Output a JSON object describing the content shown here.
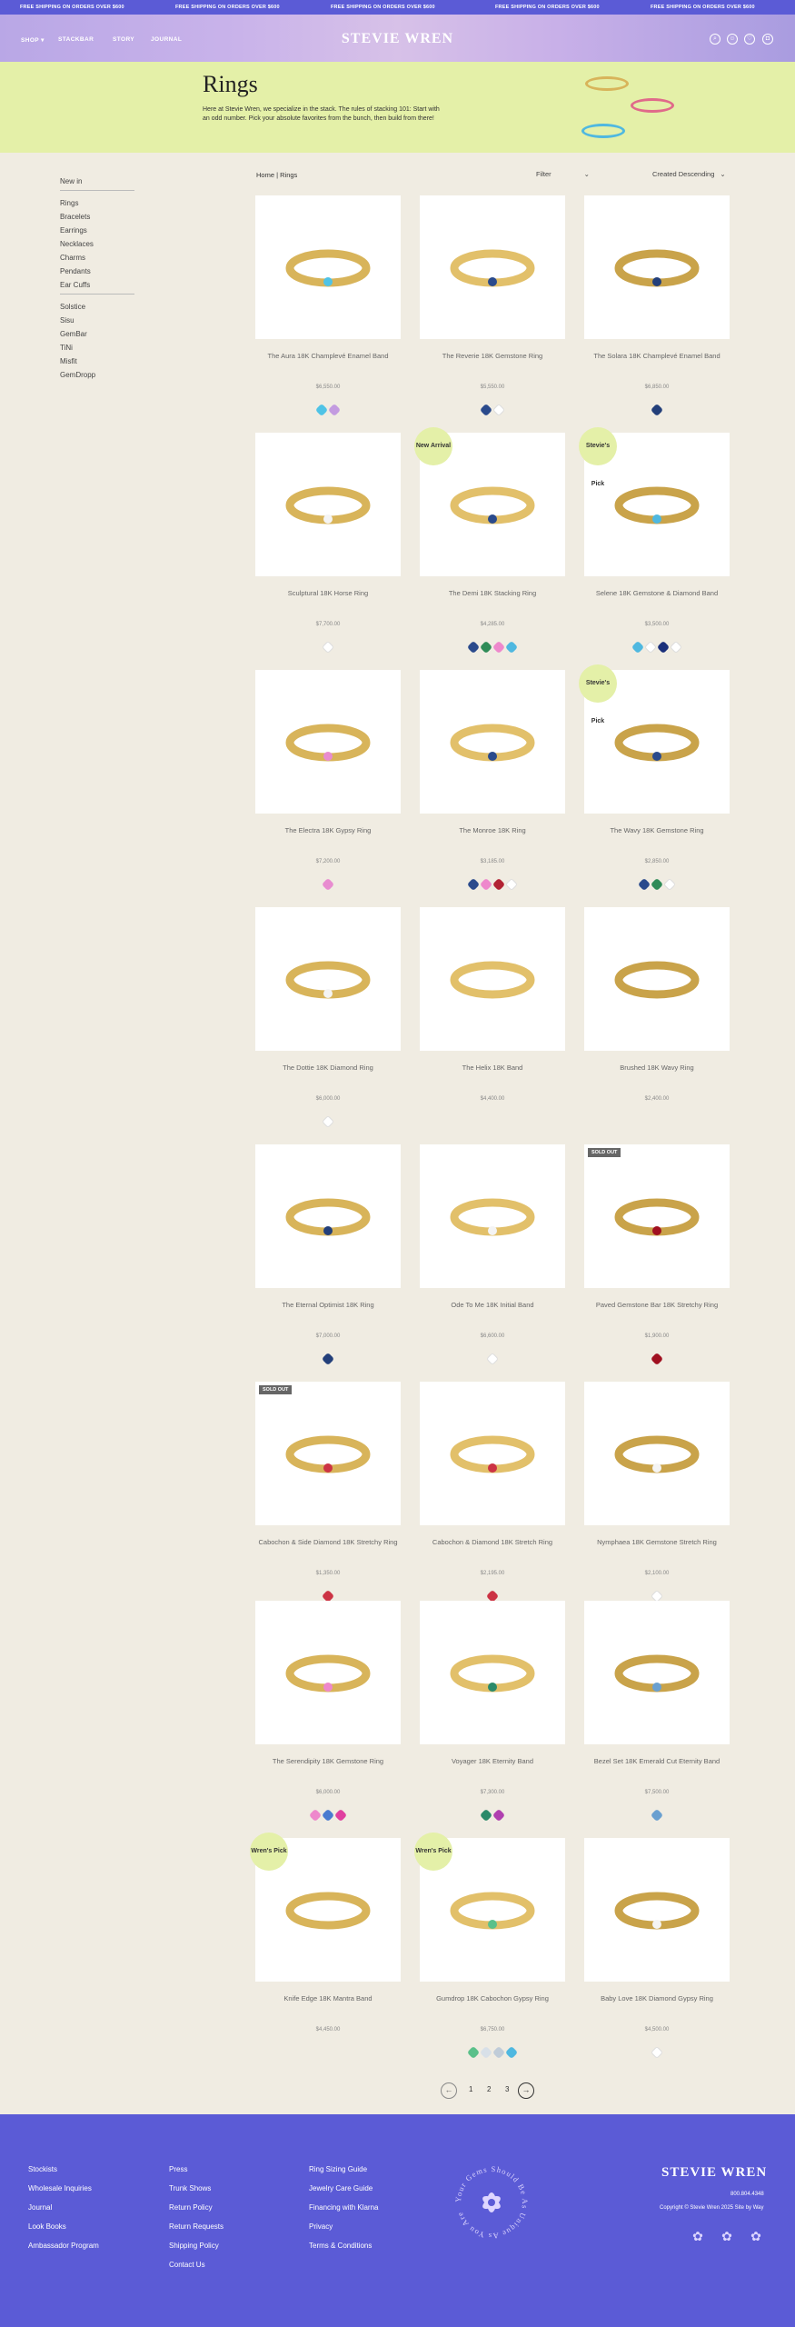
{
  "topbar": {
    "message": "FREE SHIPPING ON ORDERS OVER $600"
  },
  "header": {
    "nav": [
      "SHOP ▾",
      "STACKBAR",
      "STORY",
      "JOURNAL"
    ],
    "logo": "STEVIE WREN",
    "icons": [
      "search-icon",
      "account-icon",
      "wishlist-icon",
      "cart-icon"
    ]
  },
  "hero": {
    "title": "Rings",
    "description": "Here at Stevie Wren, we specialize in the stack. The rules of stacking 101: Start with an odd number. Pick your absolute favorites from the bunch, then build from there!"
  },
  "sidebar": {
    "new_in": "New in",
    "categories": [
      "Rings",
      "Bracelets",
      "Earrings",
      "Necklaces",
      "Charms",
      "Pendants",
      "Ear Cuffs"
    ],
    "collections": [
      "Solstice",
      "Sisu",
      "GemBar",
      "TiNi",
      "Misfit",
      "GemDropp"
    ]
  },
  "toolbar": {
    "breadcrumb": "Home | Rings",
    "filter_label": "Filter",
    "sort_label": "Created Descending"
  },
  "products": [
    {
      "name": "The Aura 18K Champlevé Enamel Band",
      "price": "$6,550.00",
      "badge": "",
      "tag": "",
      "swatches": [
        "#4fc3e6",
        "#c39be0"
      ]
    },
    {
      "name": "The Reverie 18K Gemstone Ring",
      "price": "$5,550.00",
      "badge": "",
      "tag": "",
      "swatches": [
        "#2a4a8c",
        "#ffffff"
      ]
    },
    {
      "name": "The Solara 18K Champlevé Enamel Band",
      "price": "$6,850.00",
      "badge": "",
      "tag": "",
      "swatches": [
        "#233f7a"
      ]
    },
    {
      "name": "Sculptural 18K Horse Ring",
      "price": "$7,700.00",
      "badge": "",
      "tag": "",
      "swatches": [
        "#ffffff"
      ]
    },
    {
      "name": "The Demi 18K Stacking Ring",
      "price": "$4,285.00",
      "badge": "New Arrival",
      "tag": "",
      "swatches": [
        "#2a4a8c",
        "#2e8b57",
        "#ee88cc",
        "#4fb8e0"
      ]
    },
    {
      "name": "Selene 18K Gemstone & Diamond Band",
      "price": "$3,500.00",
      "badge": "Stevie's Pick",
      "tag": "",
      "swatches": [
        "#4fb8e0",
        "#ffffff",
        "#1a2f7a",
        "#ffffff"
      ]
    },
    {
      "name": "The Electra 18K Gypsy Ring",
      "price": "$7,200.00",
      "badge": "",
      "tag": "",
      "swatches": [
        "#e88cd0"
      ]
    },
    {
      "name": "The Monroe 18K Ring",
      "price": "$3,185.00",
      "badge": "",
      "tag": "",
      "swatches": [
        "#2a4a8c",
        "#ee88cc",
        "#b22233",
        "#ffffff"
      ]
    },
    {
      "name": "The Wavy 18K Gemstone Ring",
      "price": "$2,850.00",
      "badge": "Stevie's Pick",
      "tag": "",
      "swatches": [
        "#2a4a8c",
        "#2e8b57",
        "#ffffff"
      ]
    },
    {
      "name": "The Dottie 18K Diamond Ring",
      "price": "$6,000.00",
      "badge": "",
      "tag": "",
      "swatches": [
        "#ffffff"
      ]
    },
    {
      "name": "The Helix 18K Band",
      "price": "$4,400.00",
      "badge": "",
      "tag": "",
      "swatches": []
    },
    {
      "name": "Brushed 18K Wavy Ring",
      "price": "$2,400.00",
      "badge": "",
      "tag": "",
      "swatches": []
    },
    {
      "name": "The Eternal Optimist 18K Ring",
      "price": "$7,000.00",
      "badge": "",
      "tag": "",
      "swatches": [
        "#233f7a"
      ]
    },
    {
      "name": "Ode To Me 18K Initial Band",
      "price": "$6,600.00",
      "badge": "",
      "tag": "",
      "swatches": [
        "#ffffff"
      ]
    },
    {
      "name": "Paved Gemstone Bar 18K Stretchy Ring",
      "price": "$1,900.00",
      "badge": "",
      "tag": "SOLD OUT",
      "swatches": [
        "#a01020"
      ]
    },
    {
      "name": "Cabochon & Side Diamond 18K Stretchy Ring",
      "price": "$1,350.00",
      "badge": "",
      "tag": "SOLD OUT",
      "swatches": [
        "#cc3344"
      ]
    },
    {
      "name": "Cabochon & Diamond 18K Stretch Ring",
      "price": "$2,195.00",
      "badge": "",
      "tag": "",
      "swatches": [
        "#cc3344"
      ]
    },
    {
      "name": "Nymphaea 18K Gemstone Stretch Ring",
      "price": "$2,100.00",
      "badge": "",
      "tag": "",
      "swatches": [
        "#ffffff"
      ]
    },
    {
      "name": "The Serendipity 18K Gemstone Ring",
      "price": "$6,000.00",
      "badge": "",
      "tag": "",
      "swatches": [
        "#ee88cc",
        "#4a7bd0",
        "#e040a0"
      ]
    },
    {
      "name": "Voyager 18K Eternity Band",
      "price": "$7,300.00",
      "badge": "",
      "tag": "",
      "swatches": [
        "#2a8a6a",
        "#b040b0"
      ]
    },
    {
      "name": "Bezel Set 18K Emerald Cut Eternity Band",
      "price": "$7,500.00",
      "badge": "",
      "tag": "",
      "swatches": [
        "#6aa0d0"
      ]
    },
    {
      "name": "Knife Edge 18K Mantra Band",
      "price": "$4,450.00",
      "badge": "Wren's Pick",
      "tag": "",
      "swatches": []
    },
    {
      "name": "Gumdrop 18K Cabochon Gypsy Ring",
      "price": "$6,750.00",
      "badge": "Wren's Pick",
      "tag": "",
      "swatches": [
        "#5ac08a",
        "#d8e0e8",
        "#c0ccd8",
        "#4fb8e0"
      ]
    },
    {
      "name": "Baby Love 18K Diamond Gypsy Ring",
      "price": "$4,500.00",
      "badge": "",
      "tag": "",
      "swatches": [
        "#ffffff"
      ]
    }
  ],
  "pagination": {
    "prev": "←",
    "pages": [
      "1",
      "2",
      "3"
    ],
    "next": "→"
  },
  "footer": {
    "col1": [
      "Stockists",
      "Wholesale Inquiries",
      "Journal",
      "Look Books",
      "Ambassador Program"
    ],
    "col2": [
      "Press",
      "Trunk Shows",
      "Return Policy",
      "Return Requests",
      "Shipping Policy",
      "Contact Us"
    ],
    "col3": [
      "Ring Sizing Guide",
      "Jewelry Care Guide",
      "Financing with Klarna",
      "Privacy",
      "Terms & Conditions"
    ],
    "stamp_text": "Your Gems Should Be As Unique As You Are",
    "logo": "STEVIE WREN",
    "phone": "800.804.4348",
    "copyright": "Copyright © Stevie Wren 2025 Site by Way",
    "social_icons": [
      "instagram-icon",
      "facebook-icon",
      "pinterest-icon"
    ]
  },
  "colors": {
    "accent": "#5b5bd6",
    "hero_bg": "#e4f0a8",
    "page_bg": "#f0ece2"
  }
}
